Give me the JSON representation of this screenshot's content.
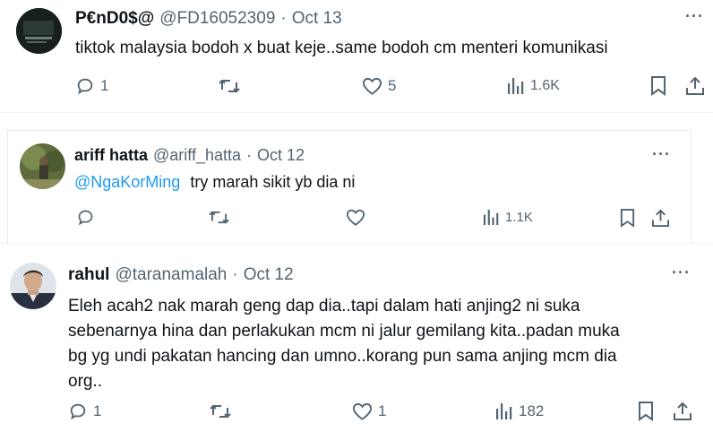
{
  "tweets": [
    {
      "display_name": "P€nD0$@",
      "handle": "@FD16052309",
      "separator": "·",
      "date": "Oct 13",
      "text": "tiktok malaysia bodoh x buat keje..same bodoh cm menteri komunikasi",
      "replies": "1",
      "retweets": "",
      "likes": "5",
      "views": "1.6K"
    },
    {
      "display_name": "ariff hatta",
      "handle": "@ariff_hatta",
      "separator": "·",
      "date": "Oct 12",
      "mention": "@NgaKorMing",
      "text": "try marah sikit yb dia ni",
      "replies": "",
      "retweets": "",
      "likes": "",
      "views": "1.1K"
    },
    {
      "display_name": "rahul",
      "handle": "@taranamalah",
      "separator": "·",
      "date": "Oct 12",
      "text_lines": [
        "Eleh acah2 nak marah geng dap dia..tapi dalam hati anjing2 ni suka",
        "sebenarnya hina dan perlakukan mcm ni jalur gemilang kita..padan muka",
        "bg yg undi pakatan hancing dan umno..korang pun sama anjing mcm dia",
        "org.."
      ],
      "replies": "1",
      "retweets": "",
      "likes": "1",
      "views": "182"
    }
  ],
  "icons": {
    "reply": "reply-icon",
    "retweet": "retweet-icon",
    "like": "heart-icon",
    "views": "views-icon",
    "bookmark": "bookmark-icon",
    "share": "share-icon",
    "more": "more-icon"
  },
  "colors": {
    "text": "#0f1419",
    "secondary": "#536471",
    "link": "#1d9bf0"
  }
}
